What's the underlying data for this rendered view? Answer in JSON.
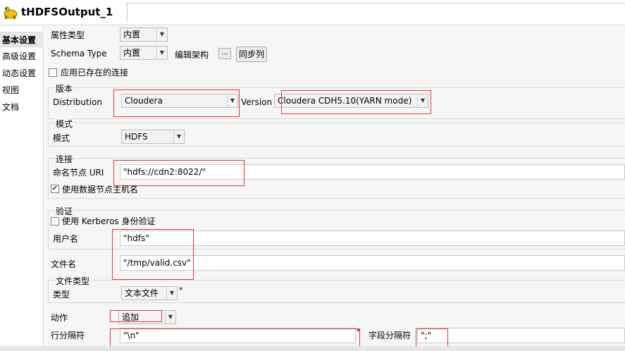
{
  "title": "tHDFSOutput_1",
  "nav": [
    "基本设置",
    "高级设置",
    "动态设置",
    "视图",
    "文档"
  ],
  "property_type": {
    "label": "属性类型",
    "value": "内置"
  },
  "schema": {
    "label": "Schema Type",
    "value": "内置",
    "edit_label": "编辑架构",
    "edit_button": "...",
    "sync_button": "同步列"
  },
  "use_existing_connection": {
    "label": "应用已存在的连接",
    "checked": false
  },
  "version_group": {
    "title": "版本",
    "distribution_label": "Distribution",
    "distribution_value": "Cloudera",
    "version_label": "Version",
    "version_value": "Cloudera CDH5.10(YARN mode)"
  },
  "mode_group": {
    "title": "模式",
    "label": "模式",
    "value": "HDFS"
  },
  "connection_group": {
    "title": "连接",
    "namenode_label": "命名节点 URI",
    "namenode_value": "\"hdfs://cdn2:8022/\"",
    "use_datanode_hostname": {
      "label": "使用数据节点主机名",
      "checked": true
    }
  },
  "auth_group": {
    "title": "验证",
    "kerberos": {
      "label": "使用 Kerberos 身份验证",
      "checked": false
    },
    "username_label": "用户名",
    "username_value": "\"hdfs\""
  },
  "filename": {
    "label": "文件名",
    "value": "\"/tmp/valid.csv\""
  },
  "filetype_group": {
    "title": "文件类型",
    "label": "类型",
    "value": "文本文件",
    "required_mark": "*"
  },
  "action": {
    "label": "动作",
    "value": "追加"
  },
  "row_separator": {
    "label": "行分隔符",
    "value": "\"\\n\"",
    "required_mark": "*"
  },
  "field_separator": {
    "label": "字段分隔符",
    "value": "\";\""
  },
  "colors": {
    "highlight_red": "#e03a3a",
    "panel_bg": "#f6f6f6"
  }
}
